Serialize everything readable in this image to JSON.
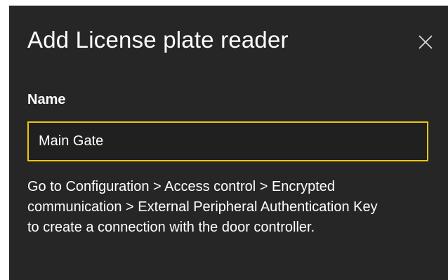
{
  "dialog": {
    "title": "Add License plate reader",
    "close_icon": "close-icon",
    "name_field": {
      "label": "Name",
      "value": "Main Gate"
    },
    "help_text": "Go to Configuration > Access control > Encrypted communication > External Peripheral Authentication Key to create a connection with the door controller."
  },
  "colors": {
    "background": "#262626",
    "text": "#ffffff",
    "input_border_focus": "#f2c40f"
  }
}
